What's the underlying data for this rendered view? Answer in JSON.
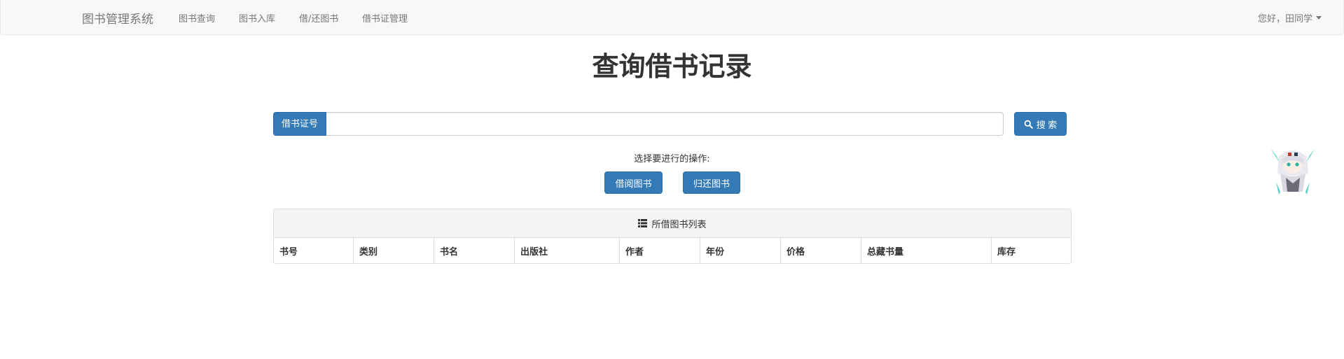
{
  "navbar": {
    "brand": "图书管理系统",
    "items": [
      {
        "label": "图书查询"
      },
      {
        "label": "图书入库"
      },
      {
        "label": "借/还图书"
      },
      {
        "label": "借书证管理"
      }
    ],
    "user": "您好，田同学"
  },
  "page": {
    "title": "查询借书记录"
  },
  "search": {
    "addon_label": "借书证号",
    "value": "",
    "placeholder": "",
    "button_label": "搜 索",
    "button_icon": "search-icon"
  },
  "operations": {
    "label": "选择要进行的操作:",
    "borrow_label": "借阅图书",
    "return_label": "归还图书"
  },
  "panel": {
    "heading": "所借图书列表",
    "heading_icon": "list-icon",
    "columns": [
      "书号",
      "类别",
      "书名",
      "出版社",
      "作者",
      "年份",
      "价格",
      "总藏书量",
      "库存"
    ],
    "rows": []
  },
  "colors": {
    "primary": "#337ab7",
    "navbar_bg": "#f8f8f8",
    "text": "#333333",
    "nav_text": "#777777"
  }
}
